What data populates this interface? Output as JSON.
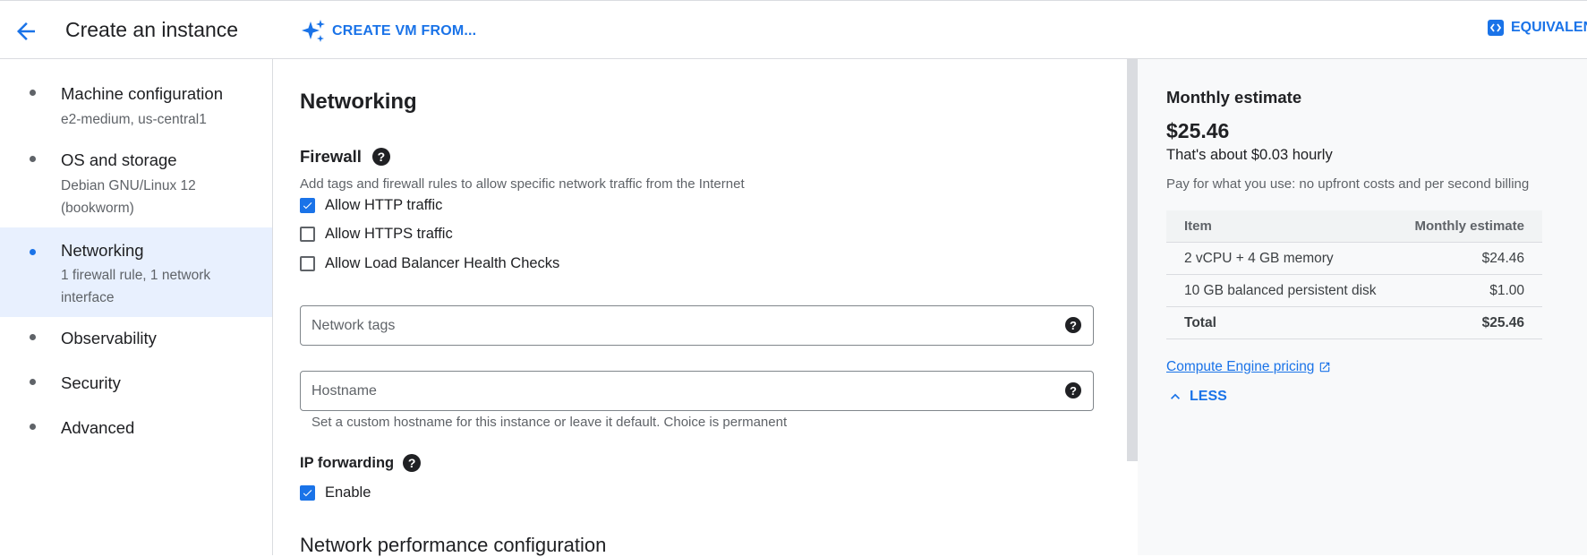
{
  "header": {
    "title": "Create an instance",
    "create_vm_label": "CREATE VM FROM...",
    "equivalent_label": "EQUIVALEN"
  },
  "sidebar": {
    "items": [
      {
        "label": "Machine configuration",
        "sub": "e2-medium, us-central1",
        "active": false
      },
      {
        "label": "OS and storage",
        "sub": "Debian GNU/Linux 12 (bookworm)",
        "active": false
      },
      {
        "label": "Networking",
        "sub": "1 firewall rule, 1 network interface",
        "active": true
      },
      {
        "label": "Observability",
        "sub": "",
        "active": false
      },
      {
        "label": "Security",
        "sub": "",
        "active": false
      },
      {
        "label": "Advanced",
        "sub": "",
        "active": false
      }
    ]
  },
  "main": {
    "heading": "Networking",
    "firewall": {
      "heading": "Firewall",
      "description": "Add tags and firewall rules to allow specific network traffic from the Internet",
      "options": [
        {
          "label": "Allow HTTP traffic",
          "checked": true
        },
        {
          "label": "Allow HTTPS traffic",
          "checked": false
        },
        {
          "label": "Allow Load Balancer Health Checks",
          "checked": false
        }
      ]
    },
    "network_tags": {
      "placeholder": "Network tags",
      "value": ""
    },
    "hostname": {
      "placeholder": "Hostname",
      "value": "",
      "hint": "Set a custom hostname for this instance or leave it default. Choice is permanent"
    },
    "ip_forwarding": {
      "heading": "IP forwarding",
      "enable_label": "Enable",
      "enabled": true
    },
    "next_section": "Network performance configuration"
  },
  "estimate": {
    "title": "Monthly estimate",
    "price": "$25.46",
    "hourly": "That's about $0.03 hourly",
    "note": "Pay for what you use: no upfront costs and per second billing",
    "table": {
      "headers": [
        "Item",
        "Monthly estimate"
      ],
      "rows": [
        {
          "item": "2 vCPU + 4 GB memory",
          "cost": "$24.46"
        },
        {
          "item": "10 GB balanced persistent disk",
          "cost": "$1.00"
        }
      ],
      "total": {
        "item": "Total",
        "cost": "$25.46"
      }
    },
    "pricing_link": "Compute Engine pricing",
    "less_label": "LESS"
  },
  "colors": {
    "accent": "#1a73e8",
    "active_bg": "#e8f0fe",
    "panel_bg": "#f8f9fa"
  }
}
